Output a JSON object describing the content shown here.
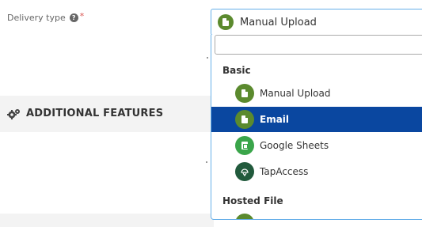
{
  "form": {
    "delivery_type_label": "Delivery type",
    "help_icon_glyph": "?",
    "required_marker": "*"
  },
  "section": {
    "title": "ADDITIONAL FEATURES",
    "icon": "gears-icon"
  },
  "select": {
    "selected_label": "Manual Upload",
    "selected_icon": "manual-upload-icon",
    "search_value": "",
    "search_placeholder": ""
  },
  "dropdown": {
    "groups": [
      {
        "label": "Basic",
        "options": [
          {
            "label": "Manual Upload",
            "icon": "manual-upload-icon",
            "color": "#5b8a2e",
            "selected": false
          },
          {
            "label": "Email",
            "icon": "email-icon",
            "color": "#5b8a2e",
            "selected": true
          },
          {
            "label": "Google Sheets",
            "icon": "google-sheets-icon",
            "color": "#3aa54a",
            "selected": false
          },
          {
            "label": "TapAccess",
            "icon": "tapaccess-icon",
            "color": "#215a3c",
            "selected": false
          }
        ]
      },
      {
        "label": "Hosted File",
        "options": []
      }
    ]
  },
  "colors": {
    "selected_bg": "#0a47a0",
    "focus_border": "#66afe9",
    "section_bg": "#f3f3f3",
    "required": "#d9534f"
  }
}
